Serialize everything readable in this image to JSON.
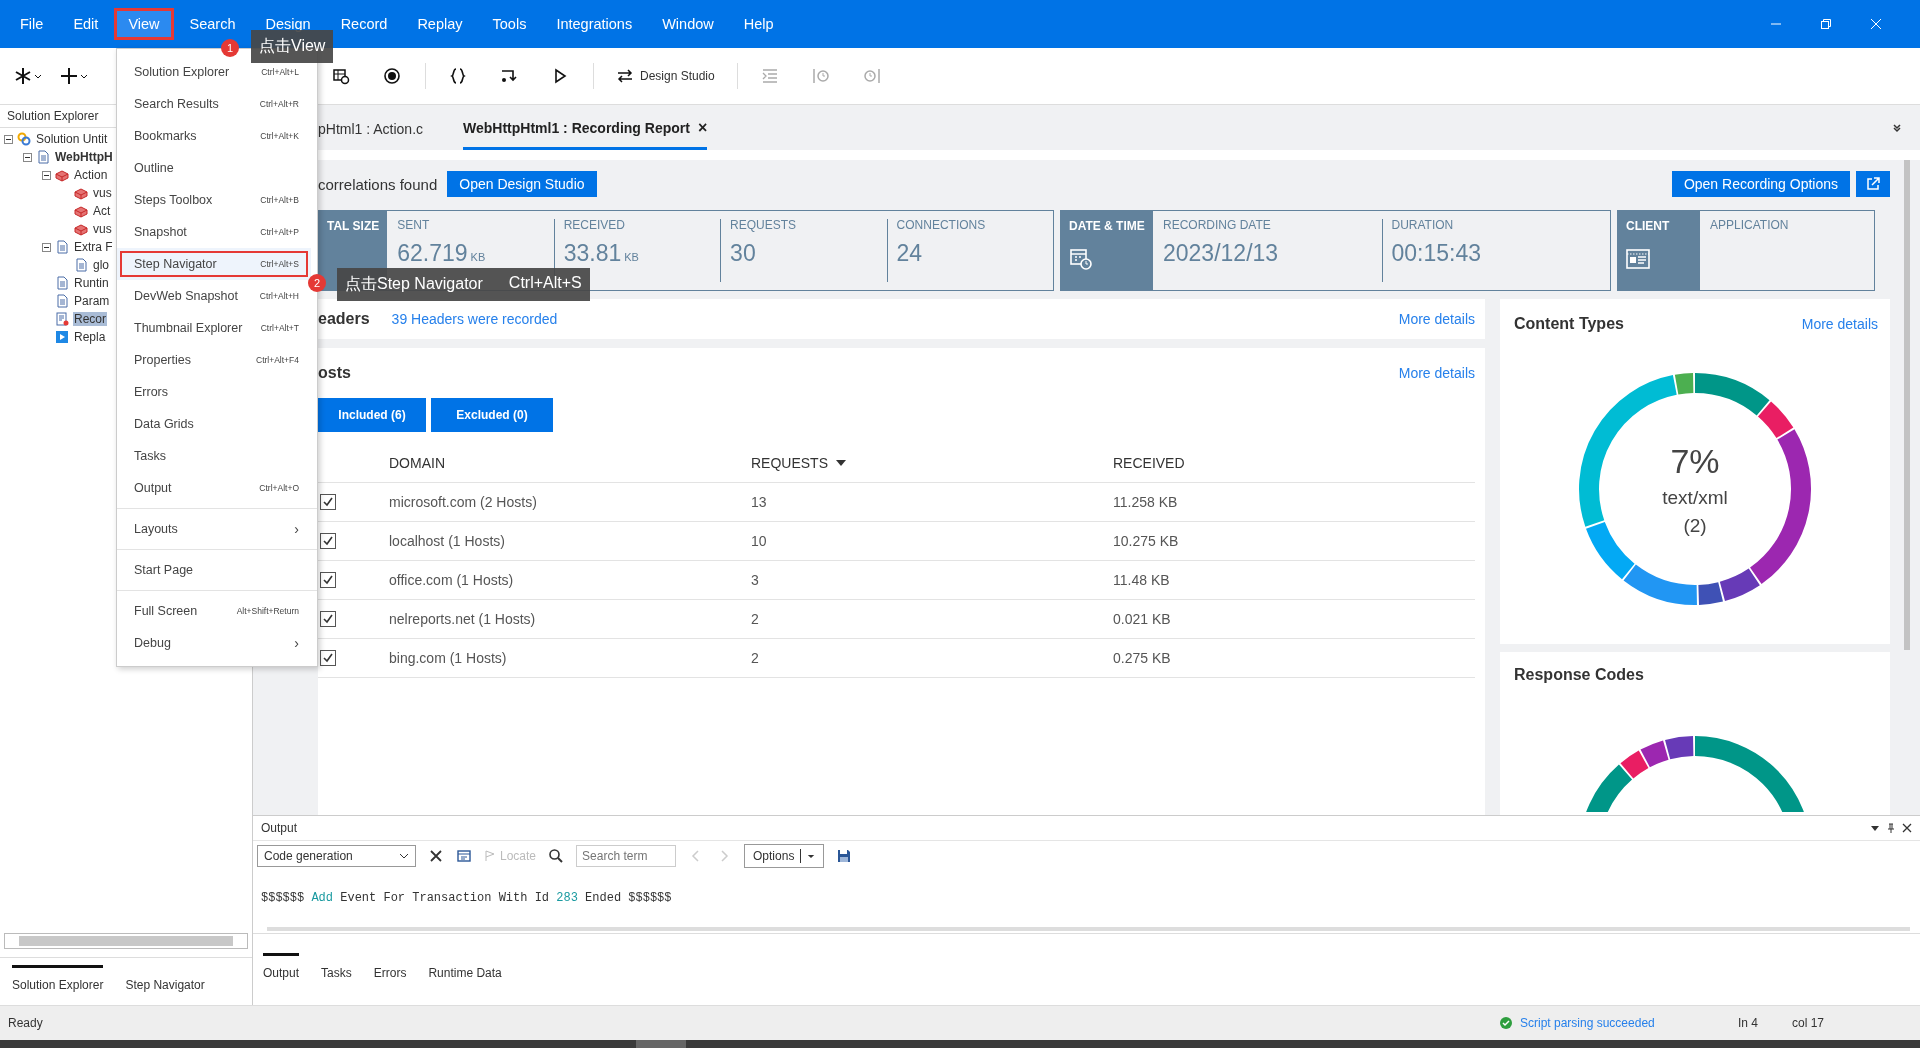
{
  "menu_bar": {
    "items": [
      {
        "label": "File",
        "selected": false
      },
      {
        "label": "Edit",
        "selected": false
      },
      {
        "label": "View",
        "selected": true
      },
      {
        "label": "Search",
        "selected": false
      },
      {
        "label": "Design",
        "selected": false
      },
      {
        "label": "Record",
        "selected": false
      },
      {
        "label": "Replay",
        "selected": false
      },
      {
        "label": "Tools",
        "selected": false
      },
      {
        "label": "Integrations",
        "selected": false
      },
      {
        "label": "Window",
        "selected": false
      },
      {
        "label": "Help",
        "selected": false
      }
    ]
  },
  "toolbar": {
    "design_studio": "Design Studio"
  },
  "solution_explorer": {
    "title": "Solution Explorer",
    "tree": [
      {
        "label": "Solution Untit",
        "kind": "solution",
        "selected": false,
        "expanded": true,
        "children": [
          {
            "label": "WebHttpH",
            "kind": "script",
            "selected": false,
            "expanded": true,
            "children": [
              {
                "label": "Action",
                "kind": "actions",
                "selected": false,
                "expanded": true,
                "children": [
                  {
                    "label": "vus",
                    "kind": "action",
                    "selected": false
                  },
                  {
                    "label": "Act",
                    "kind": "action",
                    "selected": false
                  },
                  {
                    "label": "vus",
                    "kind": "action",
                    "selected": false
                  }
                ]
              },
              {
                "label": "Extra F",
                "kind": "folder",
                "selected": false,
                "expanded": true,
                "children": [
                  {
                    "label": "glo",
                    "kind": "file",
                    "selected": false
                  }
                ]
              },
              {
                "label": "Runtin",
                "kind": "runtime",
                "selected": false
              },
              {
                "label": "Param",
                "kind": "params",
                "selected": false
              },
              {
                "label": "Recor",
                "kind": "report",
                "selected": true
              },
              {
                "label": "Repla",
                "kind": "replay",
                "selected": false
              }
            ]
          }
        ]
      }
    ],
    "tabs": [
      {
        "label": "Solution Explorer",
        "selected": true
      },
      {
        "label": "Step Navigator",
        "selected": false
      }
    ]
  },
  "view_menu": {
    "groups": [
      {
        "items": [
          {
            "label": "Solution Explorer",
            "shortcut": "Ctrl+Alt+L",
            "highlighted": false
          },
          {
            "label": "Search Results",
            "shortcut": "Ctrl+Alt+R",
            "highlighted": false
          },
          {
            "label": "Bookmarks",
            "shortcut": "Ctrl+Alt+K",
            "highlighted": false
          },
          {
            "label": "Outline",
            "highlighted": false
          },
          {
            "label": "Steps Toolbox",
            "shortcut": "Ctrl+Alt+B",
            "highlighted": false
          },
          {
            "label": "Snapshot",
            "shortcut": "Ctrl+Alt+P",
            "highlighted": false
          },
          {
            "label": "Step Navigator",
            "shortcut": "Ctrl+Alt+S",
            "highlighted": true
          },
          {
            "label": "DevWeb Snapshot",
            "shortcut": "Ctrl+Alt+H",
            "highlighted": false
          },
          {
            "label": "Thumbnail Explorer",
            "shortcut": "Ctrl+Alt+T",
            "highlighted": false
          },
          {
            "label": "Properties",
            "shortcut": "Ctrl+Alt+F4",
            "highlighted": false
          },
          {
            "label": "Errors",
            "highlighted": false
          },
          {
            "label": "Data Grids",
            "highlighted": false
          },
          {
            "label": "Tasks",
            "highlighted": false
          },
          {
            "label": "Output",
            "shortcut": "Ctrl+Alt+O",
            "highlighted": false
          }
        ]
      },
      {
        "items": [
          {
            "label": "Layouts",
            "arrow": "›",
            "highlighted": false
          }
        ]
      },
      {
        "items": [
          {
            "label": "Start Page",
            "highlighted": false
          }
        ]
      },
      {
        "items": [
          {
            "label": "Full Screen",
            "shortcut": "Alt+Shift+Return",
            "highlighted": false
          },
          {
            "label": "Debug",
            "arrow": "›",
            "highlighted": false
          }
        ]
      }
    ]
  },
  "callouts": [
    {
      "number": "1",
      "text": "点击View"
    },
    {
      "number": "2",
      "text": "点击Step Navigator",
      "shortcut": "Ctrl+Alt+S"
    }
  ],
  "editor_tabs": [
    {
      "label": "pHtml1 : Action.c",
      "selected": false
    },
    {
      "label": "WebHttpHtml1 : Recording Report",
      "selected": true,
      "close": "×"
    }
  ],
  "report": {
    "correlations": "correlations found",
    "open_design_studio": "Open Design Studio",
    "open_recording_options": "Open Recording Options",
    "stat_groups": [
      {
        "label": "TAL SIZE",
        "kind": "size",
        "stats": [
          {
            "label": "SENT",
            "value": "62.719",
            "unit": "KB"
          },
          {
            "label": "RECEIVED",
            "value": "33.81",
            "unit": "KB"
          },
          {
            "label": "REQUESTS",
            "value": "30"
          },
          {
            "label": "CONNECTIONS",
            "value": "24"
          }
        ]
      },
      {
        "label": "DATE & TIME",
        "kind": "datetime",
        "stats": [
          {
            "label": "RECORDING DATE",
            "value": "2023/12/13"
          },
          {
            "label": "DURATION",
            "value": "00:15:43"
          }
        ]
      },
      {
        "label": "CLIENT",
        "kind": "client",
        "stats": [
          {
            "label": "APPLICATION"
          }
        ]
      }
    ],
    "headers": {
      "title": "eaders",
      "link": "39 Headers were recorded",
      "more": "More details"
    },
    "hosts": {
      "title": "osts",
      "more": "More details",
      "filters": [
        "Included (6)",
        "Excluded (0)"
      ],
      "columns": [
        {
          "label": "DOMAIN",
          "sorted": false
        },
        {
          "label": "REQUESTS",
          "sorted": true
        },
        {
          "label": "RECEIVED",
          "sorted": false
        }
      ],
      "rows": [
        {
          "checked": true,
          "domain": "microsoft.com (2 Hosts)",
          "requests": "13",
          "received": "11.258 KB"
        },
        {
          "checked": true,
          "domain": "localhost (1 Hosts)",
          "requests": "10",
          "received": "10.275 KB"
        },
        {
          "checked": true,
          "domain": "office.com (1 Hosts)",
          "requests": "3",
          "received": "11.48 KB"
        },
        {
          "checked": true,
          "domain": "nelreports.net (1 Hosts)",
          "requests": "2",
          "received": "0.021 KB"
        },
        {
          "checked": true,
          "domain": "bing.com (1 Hosts)",
          "requests": "2",
          "received": "0.275 KB"
        }
      ]
    },
    "content_types": {
      "title": "Content Types",
      "more": "More details",
      "center_value": "7%",
      "center_label": "text/xml",
      "center_count": "(2)"
    },
    "response_codes": {
      "title": "Response Codes"
    }
  },
  "output": {
    "title": "Output",
    "source": "Code generation",
    "locate": "Locate",
    "search_placeholder": "Search term",
    "options": "Options",
    "line": [
      {
        "text": "$$$$$$",
        "kind": "plain"
      },
      {
        "text": "Add",
        "kind": "keyword"
      },
      {
        "text": "Event For Transaction With Id",
        "kind": "plain"
      },
      {
        "text": "283",
        "kind": "number"
      },
      {
        "text": "Ended $$$$$$",
        "kind": "plain"
      }
    ],
    "tabs": [
      {
        "label": "Output",
        "selected": true
      },
      {
        "label": "Tasks",
        "selected": false
      },
      {
        "label": "Errors",
        "selected": false
      },
      {
        "label": "Runtime Data",
        "selected": false
      }
    ]
  },
  "status_bar": {
    "status": "Ready",
    "message": "Script parsing succeeded",
    "line": "In 4",
    "column": "col 17"
  }
}
